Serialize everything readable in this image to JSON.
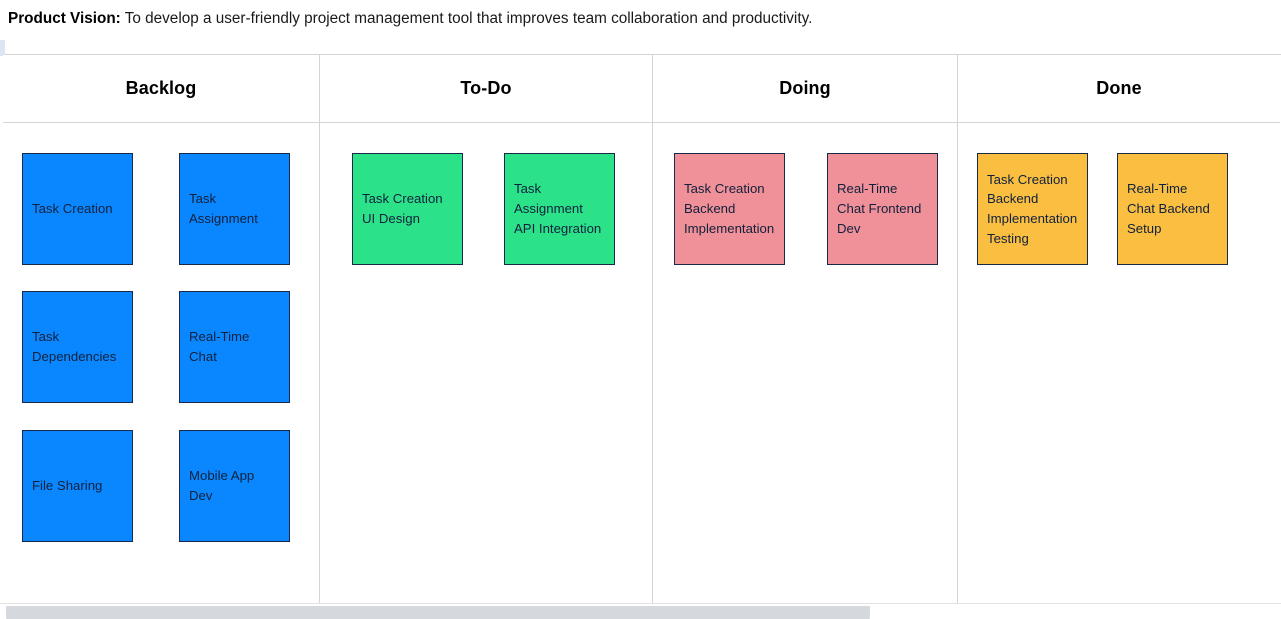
{
  "vision": {
    "label": "Product Vision:",
    "text": " To develop a user-friendly project management tool that improves team collaboration and productivity."
  },
  "colors": {
    "backlog_card": "#0a87fe",
    "todo_card": "#2ce289",
    "doing_card": "#f09098",
    "done_card": "#fabe40",
    "card_border": "#18294a",
    "card_text": "#10213d",
    "grid_line": "#d4d4d4",
    "scrollbar_thumb": "#d5d8dc"
  },
  "board": {
    "columns": [
      {
        "id": "backlog",
        "title": "Backlog",
        "cards": [
          {
            "text": "Task Creation"
          },
          {
            "text": "Task Assignment"
          },
          {
            "text": "Task Dependencies"
          },
          {
            "text": "Real-Time Chat"
          },
          {
            "text": "File Sharing"
          },
          {
            "text": "Mobile App Dev"
          }
        ]
      },
      {
        "id": "todo",
        "title": "To-Do",
        "cards": [
          {
            "text": "Task Creation UI Design"
          },
          {
            "text": "Task Assignment API Integration"
          }
        ]
      },
      {
        "id": "doing",
        "title": "Doing",
        "cards": [
          {
            "text": "Task Creation Backend Implementation"
          },
          {
            "text": "Real-Time Chat Frontend Dev"
          }
        ]
      },
      {
        "id": "done",
        "title": "Done",
        "cards": [
          {
            "text": "Task Creation Backend Implementation Testing"
          },
          {
            "text": "Real-Time Chat Backend Setup"
          }
        ]
      }
    ]
  },
  "scrollbar": {
    "orientation": "horizontal",
    "thumb_label": "horizontal-scroll-thumb"
  }
}
